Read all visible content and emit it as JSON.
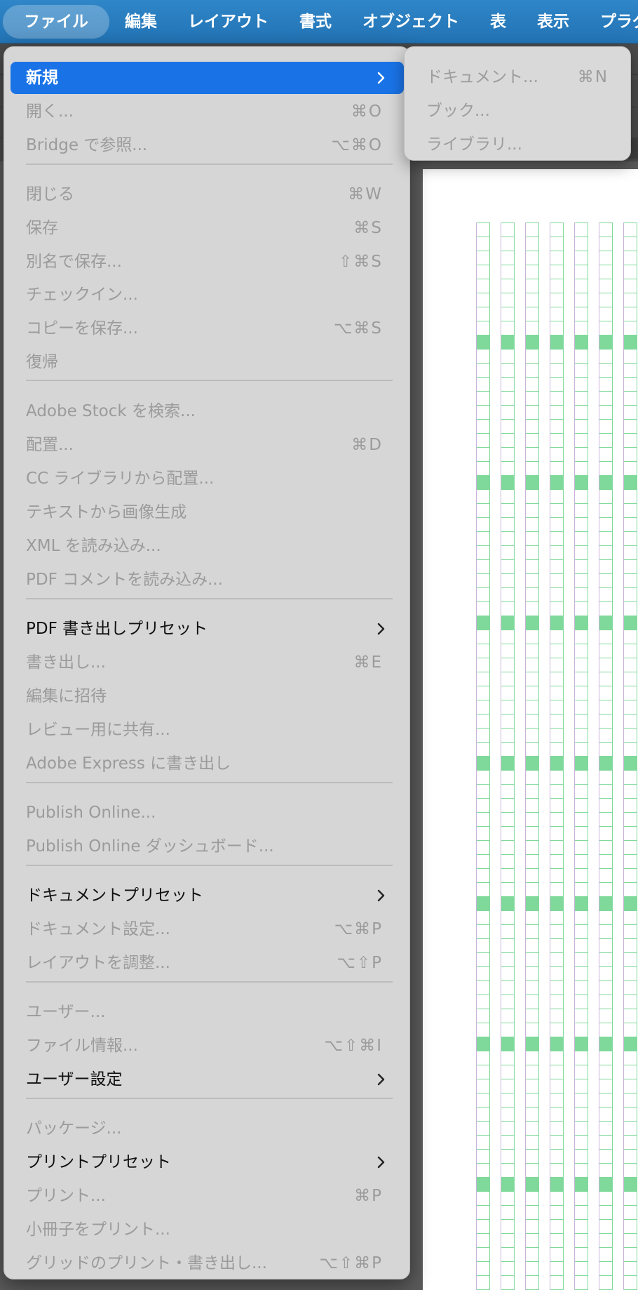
{
  "menubar": {
    "items": [
      "ファイル",
      "編集",
      "レイアウト",
      "書式",
      "オブジェクト",
      "表",
      "表示",
      "プラグ"
    ]
  },
  "file_menu": {
    "items": [
      {
        "label": "新規",
        "shortcut": "",
        "enabled": true,
        "submenu": true,
        "highlighted": true
      },
      {
        "label": "開く...",
        "shortcut": "⌘O",
        "enabled": false,
        "submenu": false
      },
      {
        "label": "Bridge で参照...",
        "shortcut": "⌥⌘O",
        "enabled": false,
        "submenu": false
      },
      {
        "label": "閉じる",
        "shortcut": "⌘W",
        "enabled": false,
        "submenu": false
      },
      {
        "label": "保存",
        "shortcut": "⌘S",
        "enabled": false,
        "submenu": false
      },
      {
        "label": "別名で保存...",
        "shortcut": "⇧⌘S",
        "enabled": false,
        "submenu": false
      },
      {
        "label": "チェックイン...",
        "shortcut": "",
        "enabled": false,
        "submenu": false
      },
      {
        "label": "コピーを保存...",
        "shortcut": "⌥⌘S",
        "enabled": false,
        "submenu": false
      },
      {
        "label": "復帰",
        "shortcut": "",
        "enabled": false,
        "submenu": false
      },
      {
        "label": "Adobe Stock を検索...",
        "shortcut": "",
        "enabled": false,
        "submenu": false
      },
      {
        "label": "配置...",
        "shortcut": "⌘D",
        "enabled": false,
        "submenu": false
      },
      {
        "label": "CC ライブラリから配置...",
        "shortcut": "",
        "enabled": false,
        "submenu": false
      },
      {
        "label": "テキストから画像生成",
        "shortcut": "",
        "enabled": false,
        "submenu": false
      },
      {
        "label": "XML を読み込み...",
        "shortcut": "",
        "enabled": false,
        "submenu": false
      },
      {
        "label": "PDF コメントを読み込み...",
        "shortcut": "",
        "enabled": false,
        "submenu": false
      },
      {
        "label": "PDF 書き出しプリセット",
        "shortcut": "",
        "enabled": true,
        "submenu": true
      },
      {
        "label": "書き出し...",
        "shortcut": "⌘E",
        "enabled": false,
        "submenu": false
      },
      {
        "label": "編集に招待",
        "shortcut": "",
        "enabled": false,
        "submenu": false
      },
      {
        "label": "レビュー用に共有...",
        "shortcut": "",
        "enabled": false,
        "submenu": false
      },
      {
        "label": "Adobe Express に書き出し",
        "shortcut": "",
        "enabled": false,
        "submenu": false
      },
      {
        "label": "Publish Online...",
        "shortcut": "",
        "enabled": false,
        "submenu": false
      },
      {
        "label": "Publish Online ダッシュボード...",
        "shortcut": "",
        "enabled": false,
        "submenu": false
      },
      {
        "label": "ドキュメントプリセット",
        "shortcut": "",
        "enabled": true,
        "submenu": true
      },
      {
        "label": "ドキュメント設定...",
        "shortcut": "⌥⌘P",
        "enabled": false,
        "submenu": false
      },
      {
        "label": "レイアウトを調整...",
        "shortcut": "⌥⇧P",
        "enabled": false,
        "submenu": false
      },
      {
        "label": "ユーザー...",
        "shortcut": "",
        "enabled": false,
        "submenu": false
      },
      {
        "label": "ファイル情報...",
        "shortcut": "⌥⇧⌘I",
        "enabled": false,
        "submenu": false
      },
      {
        "label": "ユーザー設定",
        "shortcut": "",
        "enabled": true,
        "submenu": true
      },
      {
        "label": "パッケージ...",
        "shortcut": "",
        "enabled": false,
        "submenu": false
      },
      {
        "label": "プリントプリセット",
        "shortcut": "",
        "enabled": true,
        "submenu": true
      },
      {
        "label": "プリント...",
        "shortcut": "⌘P",
        "enabled": false,
        "submenu": false
      },
      {
        "label": "小冊子をプリント...",
        "shortcut": "",
        "enabled": false,
        "submenu": false
      },
      {
        "label": "グリッドのプリント・書き出し...",
        "shortcut": "⌥⇧⌘P",
        "enabled": false,
        "submenu": false
      }
    ]
  },
  "new_submenu": {
    "items": [
      {
        "label": "ドキュメント...",
        "shortcut": "⌘N",
        "enabled": false
      },
      {
        "label": "ブック...",
        "shortcut": "",
        "enabled": false
      },
      {
        "label": "ライブラリ...",
        "shortcut": "",
        "enabled": false
      }
    ]
  },
  "colors": {
    "menubar": "#2273b4",
    "highlight": "#1a73e6",
    "menu_bg": "#d6d6d6",
    "grid_green": "#7fd99a",
    "grid_purple": "#c9b3d8"
  },
  "icons": {
    "submenu_arrow": "chevron-right-icon"
  }
}
